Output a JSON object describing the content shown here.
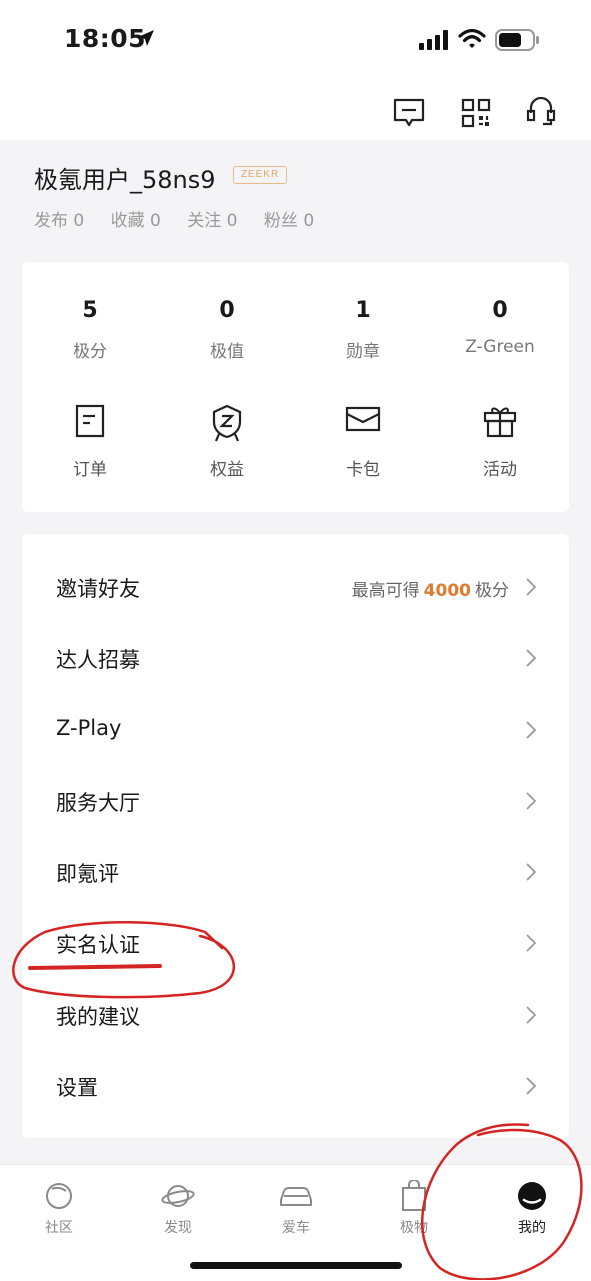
{
  "status_bar": {
    "time": "18:05"
  },
  "profile": {
    "username": "极氪用户_58ns9",
    "badge": "ZEEKR",
    "stats": [
      "发布 0",
      "收藏 0",
      "关注 0",
      "粉丝 0"
    ]
  },
  "metrics": [
    {
      "value": "5",
      "label": "极分"
    },
    {
      "value": "0",
      "label": "极值"
    },
    {
      "value": "1",
      "label": "勋章"
    },
    {
      "value": "0",
      "label": "Z-Green"
    }
  ],
  "shortcuts": [
    {
      "label": "订单",
      "icon": "order-icon"
    },
    {
      "label": "权益",
      "icon": "rights-badge-icon"
    },
    {
      "label": "卡包",
      "icon": "card-wallet-icon"
    },
    {
      "label": "活动",
      "icon": "gift-icon"
    }
  ],
  "menu": {
    "invite": {
      "label": "邀请好友",
      "extra_prefix": "最高可得",
      "extra_number": "4000",
      "extra_suffix": "极分"
    },
    "items": [
      "达人招募",
      "Z-Play",
      "服务大厅",
      "即氪评",
      "实名认证",
      "我的建议",
      "设置"
    ]
  },
  "tabs": [
    {
      "label": "社区",
      "icon": "community-icon"
    },
    {
      "label": "发现",
      "icon": "planet-icon"
    },
    {
      "label": "爱车",
      "icon": "car-icon"
    },
    {
      "label": "极物",
      "icon": "shopping-bag-icon"
    },
    {
      "label": "我的",
      "icon": "profile-icon",
      "active": true
    }
  ],
  "colors": {
    "accent_orange": "#e07a2e",
    "annotation_red": "#d42424",
    "badge_gold": "#e3a56a"
  }
}
